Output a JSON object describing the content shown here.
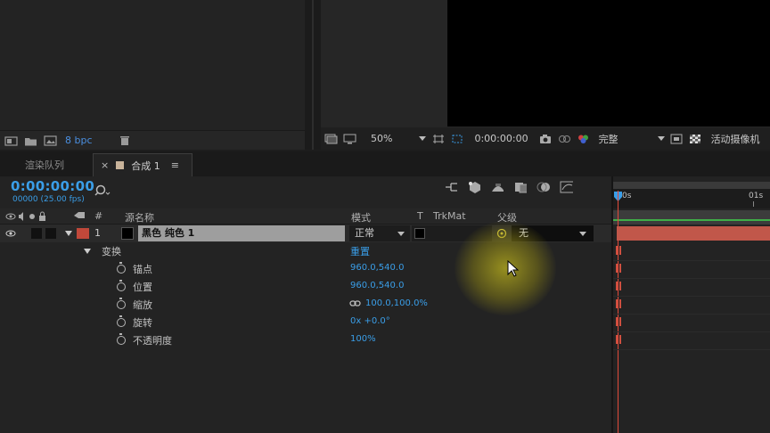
{
  "project_panel": {
    "bpc_label": "8 bpc"
  },
  "viewer": {
    "zoom": "50%",
    "timecode": "0:00:00:00",
    "resolution": "完整",
    "camera": "活动摄像机"
  },
  "tabs": {
    "render_queue": "渲染队列",
    "composition": "合成 1",
    "close_glyph": "×",
    "menu_glyph": "≡"
  },
  "timeline": {
    "current_time": "0:00:00:00",
    "frame_info": "00000 (25.00 fps)",
    "ruler": {
      "start": "0s",
      "mark_1s": "01s"
    }
  },
  "columns": {
    "hash": "#",
    "source_name": "源名称",
    "mode": "模式",
    "t": "T",
    "trkmat": "TrkMat",
    "parent": "父级"
  },
  "layer": {
    "number": "1",
    "name": "黑色 纯色 1",
    "label_color": "#c0483a",
    "mode": "正常",
    "parent": "无"
  },
  "transform": {
    "group_label": "变换",
    "reset_label": "重置",
    "properties": [
      {
        "label": "锚点",
        "value": "960.0,540.0"
      },
      {
        "label": "位置",
        "value": "960.0,540.0"
      },
      {
        "label": "缩放",
        "value": "100.0,100.0%"
      },
      {
        "label": "旋转",
        "value": "0x +0.0°"
      },
      {
        "label": "不透明度",
        "value": "100%"
      }
    ]
  },
  "colors": {
    "accent_blue": "#3a9ee8",
    "layer_bar": "#c1574a",
    "cti": "#e04a3a",
    "cursor_highlight": "#b8b020"
  }
}
